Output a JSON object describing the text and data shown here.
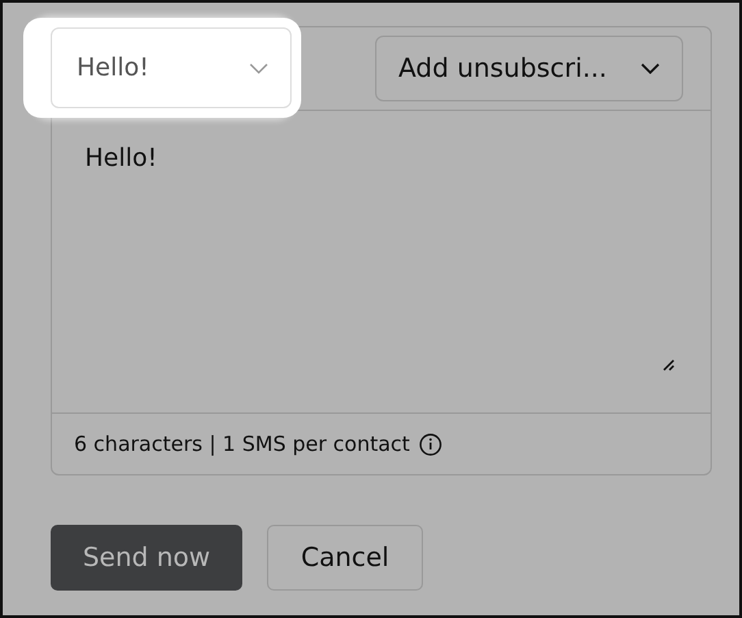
{
  "template_select": {
    "value": "Hello!",
    "highlighted": true
  },
  "unsubscribe_dropdown": {
    "label": "Add unsubscri..."
  },
  "message": {
    "value": "Hello!"
  },
  "counter": "6 characters | 1 SMS per contact",
  "buttons": [
    {
      "label": "Send now",
      "kind": "primary"
    },
    {
      "label": "Cancel",
      "kind": "secondary"
    }
  ]
}
